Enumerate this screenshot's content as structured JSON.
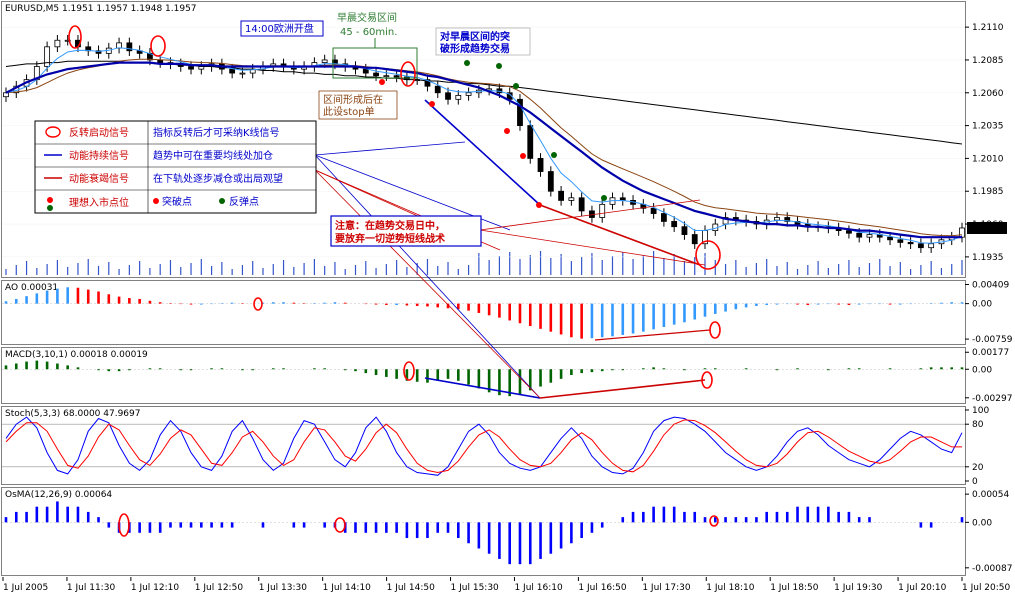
{
  "window": {
    "symbol_header": "EURUSD,M5  1.1951 1.1957 1.1948 1.1957"
  },
  "chart_data": [
    {
      "panel": "main",
      "type": "candlestick",
      "title": "EURUSD,M5",
      "ohlc_readout": "1.1951 1.1957 1.1948 1.1957",
      "last_price": "1.1957",
      "y_ticks": [
        "1.2110",
        "1.2085",
        "1.2060",
        "1.2035",
        "1.2010",
        "1.1985",
        "1.1960",
        "1.1935"
      ],
      "ylim": [
        1.1925,
        1.212
      ],
      "close_path": [
        1.206,
        1.2065,
        1.207,
        1.208,
        1.2095,
        1.21,
        1.21,
        1.2095,
        1.2092,
        1.209,
        1.2094,
        1.2098,
        1.2092,
        1.209,
        1.2085,
        1.2083,
        1.2082,
        1.208,
        1.2078,
        1.208,
        1.2082,
        1.2078,
        1.2075,
        1.2075,
        1.2078,
        1.208,
        1.2082,
        1.208,
        1.2078,
        1.208,
        1.2083,
        1.2085,
        1.2082,
        1.208,
        1.2078,
        1.2075,
        1.2073,
        1.2073,
        1.2072,
        1.207,
        1.207,
        1.2065,
        1.206,
        1.2055,
        1.2058,
        1.206,
        1.2062,
        1.2063,
        1.206,
        1.2055,
        1.2035,
        1.201,
        1.2,
        1.1985,
        1.1978,
        1.198,
        1.197,
        1.1965,
        1.1975,
        1.198,
        1.1978,
        1.1975,
        1.1972,
        1.1968,
        1.1962,
        1.1958,
        1.1952,
        1.1945,
        1.1955,
        1.196,
        1.1965,
        1.1963,
        1.1962,
        1.196,
        1.1963,
        1.1965,
        1.1962,
        1.196,
        1.1958,
        1.1958,
        1.1957,
        1.1955,
        1.1953,
        1.195,
        1.1952,
        1.195,
        1.1948,
        1.1946,
        1.1945,
        1.1942,
        1.1945,
        1.1948,
        1.195,
        1.1957
      ],
      "sma_slow_path": [
        1.206,
        1.2064,
        1.2068,
        1.2071,
        1.2074,
        1.2076,
        1.2078,
        1.2079,
        1.208,
        1.2081,
        1.2082,
        1.2083,
        1.2083,
        1.2083,
        1.2083,
        1.2082,
        1.2082,
        1.2082,
        1.2081,
        1.2081,
        1.2081,
        1.208,
        1.208,
        1.208,
        1.208,
        1.208,
        1.208,
        1.208,
        1.208,
        1.208,
        1.208,
        1.208,
        1.208,
        1.208,
        1.208,
        1.2079,
        1.2079,
        1.2078,
        1.2077,
        1.2076,
        1.2075,
        1.2073,
        1.2072,
        1.207,
        1.2068,
        1.2066,
        1.2064,
        1.2061,
        1.2058,
        1.2054,
        1.205,
        1.2045,
        1.2039,
        1.2033,
        1.2027,
        1.2021,
        1.2015,
        1.2009,
        1.2003,
        1.1998,
        1.1993,
        1.1989,
        1.1985,
        1.1982,
        1.1979,
        1.1976,
        1.1973,
        1.197,
        1.1968,
        1.1966,
        1.1964,
        1.1963,
        1.1962,
        1.1961,
        1.196,
        1.196,
        1.1959,
        1.1959,
        1.1958,
        1.1958,
        1.1957,
        1.1957,
        1.1956,
        1.1955,
        1.1955,
        1.1954,
        1.1953,
        1.1952,
        1.1951,
        1.195,
        1.195,
        1.195,
        1.195,
        1.195
      ],
      "sma_long_path": [
        1.208,
        1.2081,
        1.2082,
        1.2082,
        1.2083,
        1.2083,
        1.2084,
        1.2084,
        1.2084,
        1.2084,
        1.2084,
        1.2084,
        1.2083,
        1.2083,
        1.2083,
        1.2082,
        1.2082,
        1.2081,
        1.2081,
        1.208,
        1.208,
        1.2079,
        1.2079,
        1.2078,
        1.2078,
        1.2077,
        1.2077,
        1.2076,
        1.2076,
        1.2075,
        1.2075,
        1.2074,
        1.2074,
        1.2073,
        1.2073,
        1.2072,
        1.2072,
        1.2071,
        1.2071,
        1.207,
        1.207,
        1.2069,
        1.2069,
        1.2068,
        1.2068,
        1.2067,
        1.2067,
        1.2066,
        1.2065,
        1.2065,
        1.2064,
        1.2063,
        1.2062,
        1.2061,
        1.206,
        1.2059,
        1.2058,
        1.2057,
        1.2056,
        1.2055,
        1.2054,
        1.2053,
        1.2052,
        1.2051,
        1.205,
        1.2049,
        1.2048,
        1.2047,
        1.2046,
        1.2045,
        1.2044,
        1.2043,
        1.2042,
        1.2041,
        1.204,
        1.2039,
        1.2038,
        1.2037,
        1.2036,
        1.2035,
        1.2034,
        1.2033,
        1.2032,
        1.2031,
        1.203,
        1.2029,
        1.2028,
        1.2027,
        1.2026,
        1.2025,
        1.2024,
        1.2023,
        1.2022,
        1.2021
      ],
      "time_ticks": [
        "1 Jul 2005",
        "1 Jul 11:30",
        "1 Jul 12:10",
        "1 Jul 12:50",
        "1 Jul 13:30",
        "1 Jul 14:10",
        "1 Jul 14:50",
        "1 Jul 15:30",
        "1 Jul 16:10",
        "1 Jul 16:50",
        "1 Jul 17:30",
        "1 Jul 18:10",
        "1 Jul 18:50",
        "1 Jul 19:30",
        "1 Jul 20:10",
        "1 Jul 20:50"
      ]
    },
    {
      "panel": "AO",
      "type": "bar",
      "title": "AO 0.00031",
      "y_ticks": [
        "0.00409",
        "0.00",
        "-0.00759"
      ],
      "ylim": [
        -0.008,
        0.0042
      ],
      "values": [
        0.0005,
        0.001,
        0.0016,
        0.0022,
        0.0028,
        0.0032,
        0.0035,
        0.0034,
        0.003,
        0.0026,
        0.002,
        0.0015,
        0.0012,
        0.001,
        0.0006,
        0.0003,
        0.0001,
        -0.0001,
        -0.0002,
        -0.0002,
        -0.0001,
        0.0001,
        0.0002,
        0.0001,
        0.0,
        0.0002,
        0.0003,
        0.0003,
        0.0002,
        0.0001,
        0.0001,
        0.0002,
        0.0003,
        0.0002,
        0.0,
        -0.0001,
        -0.0002,
        -0.0003,
        -0.0003,
        -0.0004,
        -0.0005,
        -0.0006,
        -0.0008,
        -0.001,
        -0.0012,
        -0.0015,
        -0.002,
        -0.0025,
        -0.003,
        -0.0036,
        -0.0042,
        -0.0048,
        -0.0054,
        -0.006,
        -0.0066,
        -0.0072,
        -0.0075,
        -0.0074,
        -0.0072,
        -0.007,
        -0.0067,
        -0.0064,
        -0.006,
        -0.0055,
        -0.005,
        -0.0045,
        -0.004,
        -0.0034,
        -0.0028,
        -0.0022,
        -0.0017,
        -0.0012,
        -0.0008,
        -0.0005,
        -0.0003,
        -0.0002,
        -0.0001,
        -0.0002,
        -0.0003,
        -0.0002,
        -0.0001,
        -0.0002,
        -0.0003,
        -0.0002,
        -0.0001,
        -0.0001,
        -0.0002,
        -0.0002,
        -0.0001,
        0.0,
        0.0001,
        0.0002,
        0.0003,
        0.0003
      ]
    },
    {
      "panel": "MACD",
      "type": "bar",
      "title": "MACD(3,10,1) 0.00018 0.00019",
      "y_ticks": [
        "0.00177",
        "0.00",
        "-0.00297"
      ],
      "ylim": [
        -0.0032,
        0.0019
      ],
      "values": [
        0.0004,
        0.0006,
        0.0008,
        0.0009,
        0.0008,
        0.0006,
        0.0004,
        0.0002,
        0.0,
        -0.0001,
        -0.0002,
        -0.0002,
        -0.0001,
        0.0,
        0.0001,
        0.0001,
        0.0,
        -0.0001,
        -0.0001,
        0.0,
        0.0001,
        0.0001,
        0.0,
        -0.0001,
        -0.0001,
        0.0,
        0.0001,
        0.0001,
        0.0,
        0.0,
        0.0001,
        0.0001,
        0.0,
        -0.0001,
        -0.0002,
        -0.0004,
        -0.0006,
        -0.0008,
        -0.001,
        -0.0012,
        -0.0013,
        -0.0014,
        -0.0012,
        -0.001,
        -0.0012,
        -0.0016,
        -0.002,
        -0.0024,
        -0.0027,
        -0.0028,
        -0.0026,
        -0.0022,
        -0.0018,
        -0.0014,
        -0.001,
        -0.0006,
        -0.0004,
        -0.0003,
        -0.0002,
        -0.0001,
        -0.0001,
        0.0,
        0.0001,
        0.0002,
        0.0001,
        0.0,
        -0.0001,
        0.0,
        0.0001,
        0.0001,
        0.0,
        0.0,
        0.0001,
        0.0,
        0.0,
        -0.0001,
        0.0,
        0.0001,
        0.0,
        0.0,
        -0.0001,
        0.0,
        0.0001,
        0.0001,
        0.0,
        0.0,
        0.0001,
        0.0,
        0.0,
        0.0001,
        0.0002,
        0.0002,
        0.0002,
        0.0002
      ]
    },
    {
      "panel": "Stoch",
      "type": "line",
      "title": "Stoch(5,3,3) 68.0000 47.9697",
      "y_ticks": [
        "100",
        "80",
        "20",
        "0"
      ],
      "ylim": [
        0,
        100
      ],
      "series": [
        {
          "values": [
            60,
            80,
            90,
            75,
            40,
            15,
            10,
            30,
            70,
            88,
            82,
            50,
            25,
            15,
            30,
            65,
            85,
            70,
            40,
            20,
            15,
            35,
            70,
            85,
            60,
            30,
            15,
            25,
            60,
            85,
            80,
            55,
            30,
            20,
            40,
            75,
            90,
            70,
            40,
            20,
            12,
            10,
            8,
            20,
            45,
            70,
            80,
            65,
            40,
            25,
            18,
            15,
            20,
            40,
            60,
            75,
            60,
            35,
            20,
            12,
            10,
            18,
            40,
            70,
            85,
            90,
            88,
            80,
            70,
            55,
            40,
            30,
            20,
            15,
            20,
            35,
            55,
            70,
            75,
            65,
            50,
            40,
            30,
            25,
            20,
            30,
            45,
            60,
            70,
            65,
            55,
            45,
            40,
            68
          ]
        },
        {
          "values": [
            55,
            70,
            82,
            82,
            70,
            45,
            22,
            18,
            35,
            62,
            80,
            72,
            50,
            30,
            22,
            38,
            60,
            72,
            65,
            45,
            25,
            22,
            40,
            62,
            70,
            55,
            35,
            22,
            30,
            55,
            75,
            72,
            55,
            35,
            28,
            45,
            68,
            80,
            68,
            45,
            25,
            15,
            12,
            15,
            28,
            48,
            65,
            72,
            62,
            45,
            30,
            22,
            20,
            25,
            40,
            58,
            68,
            58,
            40,
            25,
            15,
            13,
            22,
            42,
            65,
            80,
            86,
            85,
            78,
            68,
            55,
            42,
            30,
            22,
            20,
            25,
            38,
            55,
            68,
            70,
            62,
            52,
            42,
            35,
            28,
            25,
            30,
            42,
            55,
            62,
            62,
            55,
            48,
            48
          ]
        }
      ]
    },
    {
      "panel": "OsMA",
      "type": "bar",
      "title": "OsMA(12,26,9) 0.00064",
      "y_ticks": [
        "0.00054",
        "0.00",
        "-0.00087"
      ],
      "ylim": [
        -0.00095,
        0.0006
      ],
      "values": [
        0.0001,
        0.0002,
        0.0002,
        0.0003,
        0.0003,
        0.0004,
        0.0003,
        0.0003,
        0.0002,
        0.0001,
        -0.0001,
        -0.0002,
        -0.0002,
        -0.0002,
        -0.0002,
        -0.0002,
        -0.0001,
        -0.0001,
        -0.0001,
        -0.0001,
        -0.0001,
        -0.0001,
        -0.0001,
        0.0,
        0.0,
        -0.0001,
        0.0,
        0.0,
        -0.0001,
        -0.0001,
        0.0,
        -0.0001,
        -0.0001,
        -0.0002,
        -0.0002,
        -0.0002,
        -0.0002,
        -0.0002,
        -0.0002,
        -0.0003,
        -0.0003,
        -0.0003,
        -0.0002,
        -0.0002,
        -0.0003,
        -0.0004,
        -0.0005,
        -0.0006,
        -0.0007,
        -0.0008,
        -0.0008,
        -0.0008,
        -0.0007,
        -0.0006,
        -0.0005,
        -0.0004,
        -0.0003,
        -0.0002,
        -0.0001,
        0.0,
        0.0001,
        0.0002,
        0.0002,
        0.0003,
        0.0003,
        0.0003,
        0.0002,
        0.0002,
        0.0001,
        0.0001,
        0.0001,
        0.0001,
        0.0001,
        0.0001,
        0.0002,
        0.0002,
        0.0002,
        0.0003,
        0.0003,
        0.0003,
        0.0003,
        0.0002,
        0.0002,
        0.0001,
        0.0001,
        0.0,
        0.0,
        0.0,
        0.0,
        -0.0001,
        -0.0001,
        0.0,
        0.0,
        0.0001
      ]
    }
  ],
  "annotations": {
    "europe_open": "14:00欧洲开盘",
    "morning_range_title": "早晨交易区间",
    "morning_range_time": "45 - 60min.",
    "breakout_line1": "对早晨区间的突",
    "breakout_line2": "破形成趋势交易",
    "stop_line1": "区间形成后在",
    "stop_line2": "此设stop单",
    "warning_line1": "注意：在趋势交易日中，",
    "warning_line2": "要放弃一切逆势短线战术"
  },
  "legend": {
    "rows": [
      {
        "left": "反转启动信号",
        "right": "指标反转后才可采纳K线信号"
      },
      {
        "left": "动能持续信号",
        "right": "趋势中可在重要均线处加仓"
      },
      {
        "left": "动能衰竭信号",
        "right": "在下轨处逐步减仓或出局观望"
      },
      {
        "left": "理想入市点位",
        "right_a": "突破点",
        "right_b": "反弹点"
      }
    ]
  },
  "colors": {
    "bull_candle": "#ffffff",
    "bear_candle": "#000000",
    "sma_fast": "#3399ff",
    "sma_mid": "#8b4513",
    "sma_slow": "#0000aa",
    "sma_long": "#000000",
    "ao_up": "#3399ff",
    "ao_down": "#ff0000",
    "macd_up": "#006400",
    "macd_down": "#006400",
    "osma": "#0000ff",
    "stoch_main": "#0000ff",
    "stoch_signal": "#ff0000",
    "signal_circle": "#ff0000",
    "entry_breakout": "#ff0000",
    "entry_rebound": "#006400",
    "annotation_blue": "#0000cc",
    "annotation_red": "#cc0000",
    "annotation_green": "#2e7d32"
  }
}
